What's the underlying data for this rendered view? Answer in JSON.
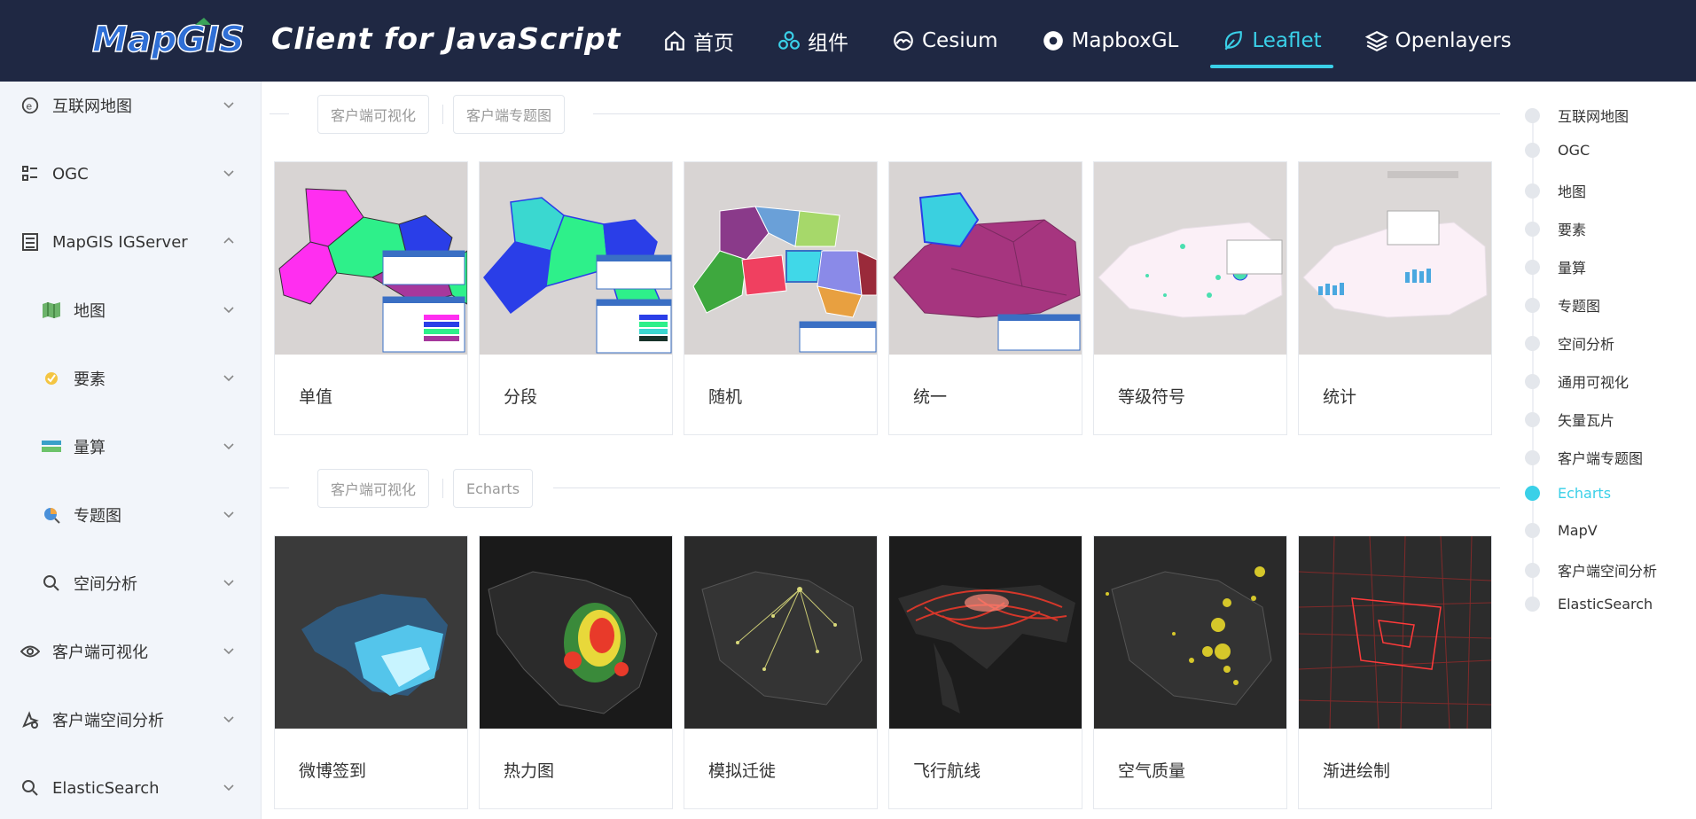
{
  "header": {
    "brand": "Client for JavaScript",
    "logo_text": "MapGIS",
    "nav": [
      {
        "label": "首页",
        "icon": "home-icon"
      },
      {
        "label": "组件",
        "icon": "components-icon"
      },
      {
        "label": "Cesium",
        "icon": "cesium-icon"
      },
      {
        "label": "MapboxGL",
        "icon": "mapbox-icon"
      },
      {
        "label": "Leaflet",
        "icon": "leaf-icon",
        "active": true
      },
      {
        "label": "Openlayers",
        "icon": "layers-icon"
      }
    ],
    "accent_color": "#3ad0e8",
    "bg_color": "#1f2843"
  },
  "sidebar": {
    "items": [
      {
        "label": "互联网地图",
        "icon": "internet-map-icon",
        "expanded": false
      },
      {
        "label": "OGC",
        "icon": "ogc-icon",
        "expanded": false
      },
      {
        "label": "MapGIS IGServer",
        "icon": "server-icon",
        "expanded": true
      },
      {
        "label": "地图",
        "icon": "map-icon",
        "expanded": false
      },
      {
        "label": "要素",
        "icon": "feature-icon",
        "expanded": false
      },
      {
        "label": "量算",
        "icon": "measure-icon",
        "expanded": false
      },
      {
        "label": "专题图",
        "icon": "thematic-icon",
        "expanded": false
      },
      {
        "label": "空间分析",
        "icon": "search-icon",
        "expanded": false
      },
      {
        "label": "客户端可视化",
        "icon": "eye-icon",
        "expanded": false
      },
      {
        "label": "客户端空间分析",
        "icon": "analysis-icon",
        "expanded": false
      },
      {
        "label": "ElasticSearch",
        "icon": "search-icon",
        "expanded": false
      }
    ]
  },
  "sections": [
    {
      "chips": [
        "客户端可视化",
        "客户端专题图"
      ],
      "cards": [
        {
          "label": "单值",
          "thumb": "thematic-unique"
        },
        {
          "label": "分段",
          "thumb": "thematic-range"
        },
        {
          "label": "随机",
          "thumb": "thematic-random"
        },
        {
          "label": "统一",
          "thumb": "thematic-uniform"
        },
        {
          "label": "等级符号",
          "thumb": "thematic-graduated"
        },
        {
          "label": "统计",
          "thumb": "thematic-chart"
        }
      ]
    },
    {
      "chips": [
        "客户端可视化",
        "Echarts"
      ],
      "cards": [
        {
          "label": "微博签到",
          "thumb": "echarts-weibo"
        },
        {
          "label": "热力图",
          "thumb": "echarts-heatmap"
        },
        {
          "label": "模拟迁徙",
          "thumb": "echarts-migration"
        },
        {
          "label": "飞行航线",
          "thumb": "echarts-flight"
        },
        {
          "label": "空气质量",
          "thumb": "echarts-air"
        },
        {
          "label": "渐进绘制",
          "thumb": "echarts-progressive"
        }
      ]
    }
  ],
  "anchor": {
    "items": [
      {
        "label": "互联网地图"
      },
      {
        "label": "OGC"
      },
      {
        "label": "地图"
      },
      {
        "label": "要素"
      },
      {
        "label": "量算"
      },
      {
        "label": "专题图"
      },
      {
        "label": "空间分析"
      },
      {
        "label": "通用可视化"
      },
      {
        "label": "矢量瓦片"
      },
      {
        "label": "客户端专题图"
      },
      {
        "label": "Echarts",
        "active": true
      },
      {
        "label": "MapV"
      },
      {
        "label": "客户端空间分析"
      },
      {
        "label": "ElasticSearch"
      }
    ]
  }
}
